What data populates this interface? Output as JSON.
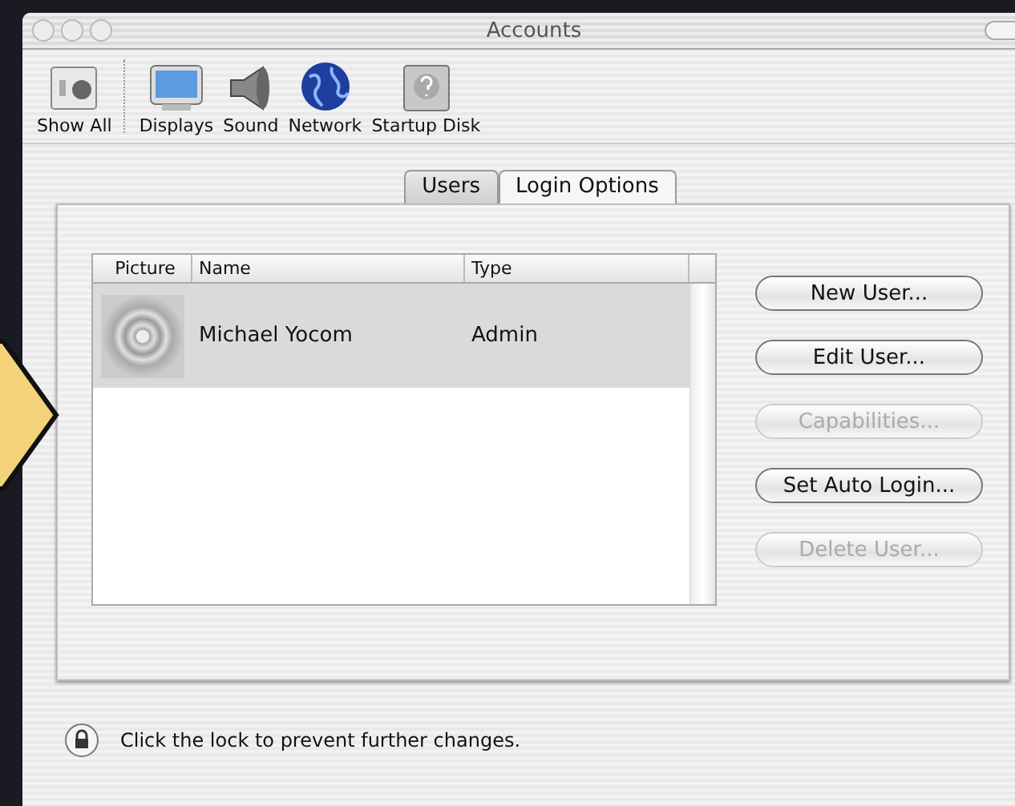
{
  "window": {
    "title": "Accounts"
  },
  "toolbar": [
    {
      "kind": "show-all",
      "label": "Show All"
    },
    {
      "kind": "display",
      "label": "Displays"
    },
    {
      "kind": "sound",
      "label": "Sound"
    },
    {
      "kind": "network",
      "label": "Network"
    },
    {
      "kind": "disk",
      "label": "Startup Disk"
    }
  ],
  "tabs": [
    {
      "label": "Users",
      "selected": true
    },
    {
      "label": "Login Options",
      "selected": false
    }
  ],
  "table": {
    "columns": [
      "Picture",
      "Name",
      "Type"
    ],
    "rows": [
      {
        "name": "Michael Yocom",
        "type": "Admin",
        "selected": true
      }
    ]
  },
  "buttons": [
    {
      "label": "New User...",
      "disabled": false
    },
    {
      "label": "Edit User...",
      "disabled": false
    },
    {
      "label": "Capabilities...",
      "disabled": true
    },
    {
      "label": "Set Auto Login...",
      "disabled": false
    },
    {
      "label": "Delete User...",
      "disabled": true
    }
  ],
  "lock_message": "Click the lock to prevent further changes."
}
